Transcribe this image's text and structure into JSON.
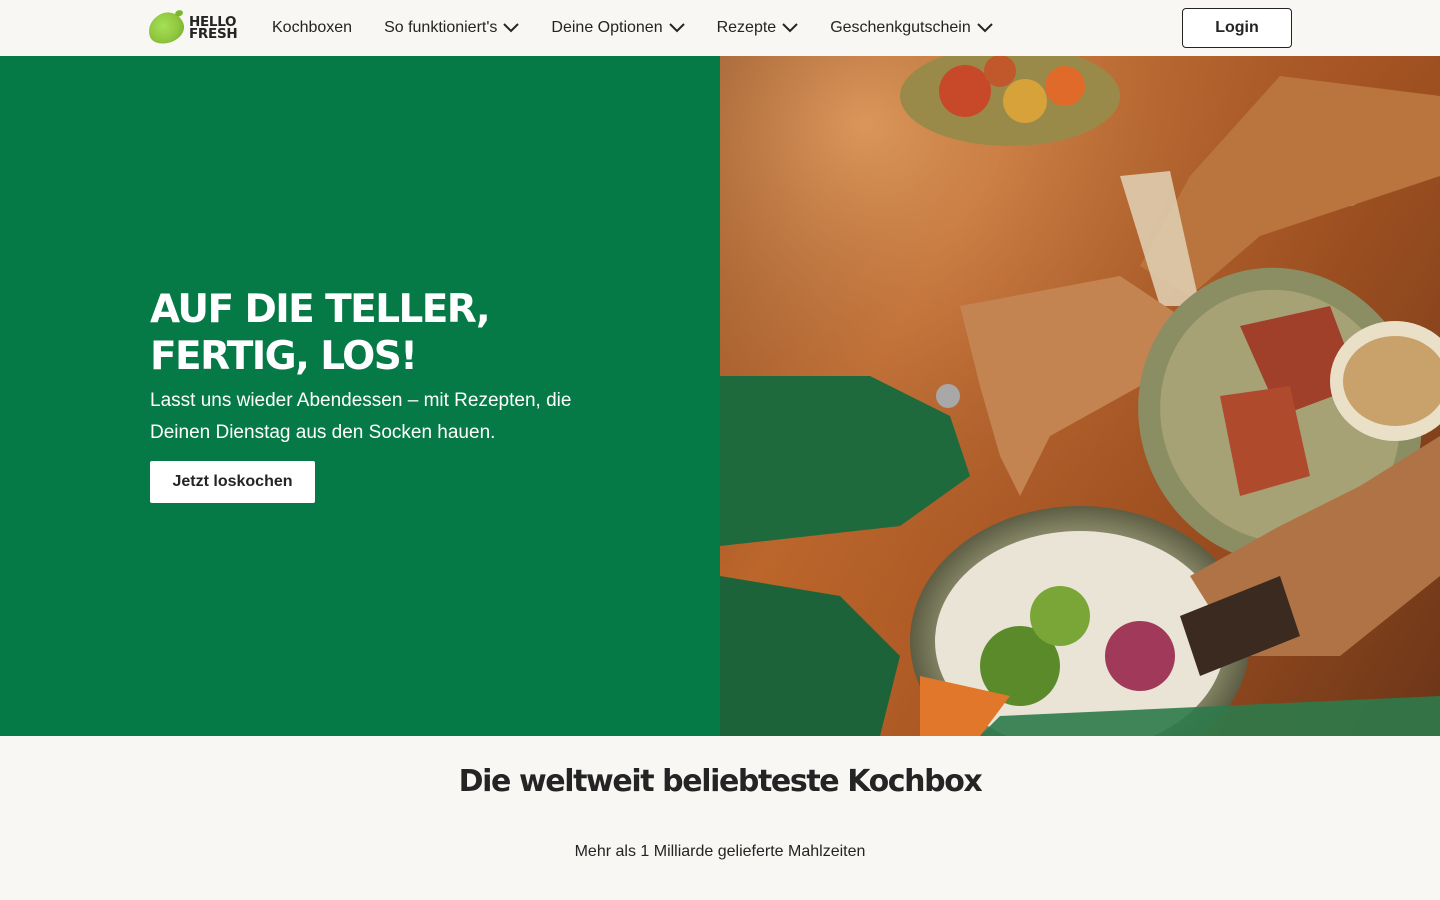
{
  "brand": {
    "line1": "HELLO",
    "line2": "FRESH",
    "accent": "#067a46",
    "lime": "#91c73e"
  },
  "nav": {
    "items": [
      {
        "label": "Kochboxen",
        "dropdown": false
      },
      {
        "label": "So funktioniert's",
        "dropdown": true
      },
      {
        "label": "Deine Optionen",
        "dropdown": true
      },
      {
        "label": "Rezepte",
        "dropdown": true
      },
      {
        "label": "Geschenkgutschein",
        "dropdown": true
      }
    ],
    "login_label": "Login"
  },
  "hero": {
    "title": "Auf die Teller, fertig, los!",
    "subtitle": "Lasst uns wieder Abendessen – mit Rezepten, die Deinen Dienstag aus den Socken hauen.",
    "cta_label": "Jetzt loskochen",
    "image_icon": "food-photo"
  },
  "section": {
    "title": "Die weltweit beliebteste Kochbox",
    "subtitle": "Mehr als 1 Milliarde gelieferte Mahlzeiten"
  }
}
